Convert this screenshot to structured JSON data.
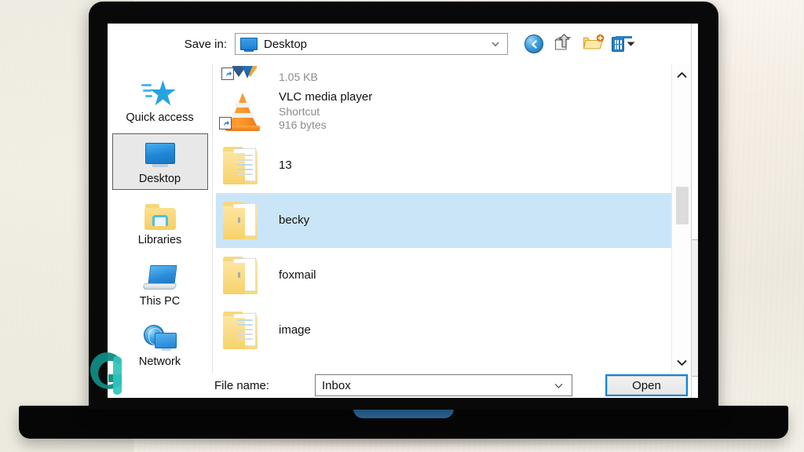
{
  "window": {
    "type": "windows-file-save-dialog"
  },
  "topbar": {
    "save_in_label": "Save in:",
    "location_value": "Desktop",
    "location_icon": "desktop-monitor-icon",
    "buttons": [
      {
        "name": "back-button",
        "icon": "back-arrow-icon"
      },
      {
        "name": "up-one-level-button",
        "icon": "up-folder-arrow-icon"
      },
      {
        "name": "new-folder-button",
        "icon": "new-folder-icon"
      },
      {
        "name": "views-button",
        "icon": "views-grid-icon"
      },
      {
        "name": "views-dropdown",
        "icon": "caret-down-icon"
      }
    ]
  },
  "sidebar": {
    "items": [
      {
        "label": "Quick access",
        "icon": "blue-star-icon",
        "selected": false
      },
      {
        "label": "Desktop",
        "icon": "desktop-monitor-icon",
        "selected": true
      },
      {
        "label": "Libraries",
        "icon": "yellow-folder-library-icon",
        "selected": false
      },
      {
        "label": "This PC",
        "icon": "laptop-computer-icon",
        "selected": false
      },
      {
        "label": "Network",
        "icon": "globe-network-icon",
        "selected": false
      }
    ]
  },
  "file_list": {
    "items": [
      {
        "name": "",
        "kind": "",
        "size": "1.05 KB",
        "icon": "app-shortcut-icon",
        "shortcut": true,
        "selected": false,
        "partial": true
      },
      {
        "name": "VLC media player",
        "kind": "Shortcut",
        "size": "916 bytes",
        "icon": "vlc-cone-icon",
        "shortcut": true,
        "selected": false,
        "partial": false
      },
      {
        "name": "13",
        "kind": "",
        "size": "",
        "icon": "folder-icon",
        "shortcut": false,
        "selected": false,
        "partial": false
      },
      {
        "name": "becky",
        "kind": "",
        "size": "",
        "icon": "folder-icon",
        "shortcut": false,
        "selected": true,
        "partial": false
      },
      {
        "name": "foxmail",
        "kind": "",
        "size": "",
        "icon": "folder-icon",
        "shortcut": false,
        "selected": false,
        "partial": false
      },
      {
        "name": "image",
        "kind": "",
        "size": "",
        "icon": "folder-icon",
        "shortcut": false,
        "selected": false,
        "partial": false
      }
    ],
    "scrollbar": {
      "up_icon": "chevron-up-icon",
      "down_icon": "chevron-down-icon"
    }
  },
  "footer": {
    "file_name_label": "File name:",
    "file_name_value": "Inbox",
    "open_button_label": "Open"
  },
  "colors": {
    "selection_blue": "#cbe5f8",
    "focus_blue": "#0a85e0",
    "accent_blue": "#2b7fc4",
    "watermark_teal": "#189c95",
    "laptop_black": "#090909",
    "background_cream": "#f2efe6",
    "trackpad_blue": "#2d6da3"
  }
}
